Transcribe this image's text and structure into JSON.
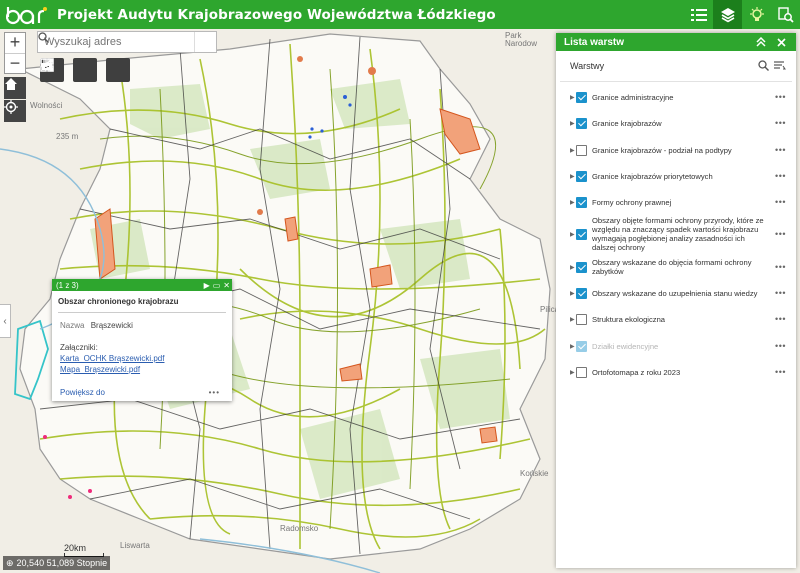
{
  "header": {
    "logo_text": "bgr",
    "title": "Projekt Audytu Krajobrazowego Województwa Łódzkiego",
    "tool_icons": [
      "legend-icon",
      "layers-icon",
      "bulb-icon",
      "analysis-icon"
    ],
    "accent": "#2ea62e"
  },
  "search": {
    "placeholder": "Wyszukaj adres"
  },
  "zoom": {
    "in": "+",
    "out": "−"
  },
  "map": {
    "labels": {
      "park": "Park",
      "narodowy": "Narodow",
      "distance": "235 m",
      "wolnosci": "Wolności",
      "pilica": "Pilica",
      "konskie": "Końskie",
      "radomsko": "Radomsko",
      "liswarta": "Liswarta"
    },
    "scale_label": "20km",
    "coords": "20,540 51,089 Stopnie",
    "collapse_glyph": "‹"
  },
  "popup": {
    "counter": "(1 z 3)",
    "title": "Obszar chronionego krajobrazu",
    "field_name": "Nazwa",
    "field_value": "Brąszewicki",
    "attachments_label": "Załączniki:",
    "attachments": [
      "Karta_OCHK Brąszewicki.pdf",
      "Mapa_Brąszewicki.pdf"
    ],
    "zoom_link": "Powiększ do",
    "more": "•••"
  },
  "panel": {
    "title": "Lista warstw",
    "subtitle": "Warstwy",
    "more": "•••",
    "layers": [
      {
        "label": "Granice administracyjne",
        "checked": true
      },
      {
        "label": "Granice krajobrazów",
        "checked": true
      },
      {
        "label": "Granice krajobrazów - podział na podtypy",
        "checked": false
      },
      {
        "label": "Granice krajobrazów priorytetowych",
        "checked": true
      },
      {
        "label": "Formy ochrony prawnej",
        "checked": true
      },
      {
        "label": "Obszary objęte formami ochrony przyrody, które ze względu na znaczący spadek wartości krajobrazu wymagają pogłębionej analizy zasadności ich dalszej ochrony",
        "checked": true
      },
      {
        "label": "Obszary wskazane do objęcia formami ochrony zabytków",
        "checked": true
      },
      {
        "label": "Obszary wskazane do uzupełnienia stanu wiedzy",
        "checked": true
      },
      {
        "label": "Struktura ekologiczna",
        "checked": false
      },
      {
        "label": "Działki ewidencyjne",
        "checked": true,
        "dimmed": true
      },
      {
        "label": "Ortofotomapa z roku 2023",
        "checked": false
      }
    ]
  }
}
